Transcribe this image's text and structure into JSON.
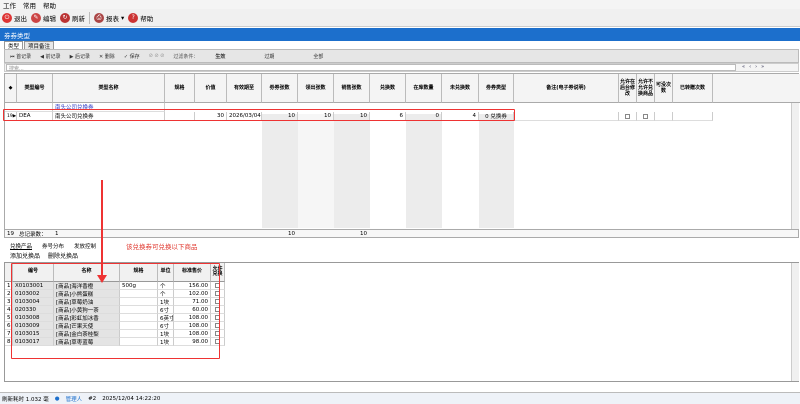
{
  "menu": {
    "items": [
      "工作",
      "常用",
      "帮助"
    ]
  },
  "toolbar": {
    "exit": "退出",
    "edit": "编辑",
    "refresh": "刷新",
    "report": "报表",
    "help": "帮助"
  },
  "window_title": "劵券类型",
  "tabs": [
    "类型",
    "项目备注"
  ],
  "nav": {
    "first": "首记录",
    "prev": "前记录",
    "next": "后记录",
    "del": "删除",
    "save": "保存",
    "filter_label": "过滤条件：",
    "status": "生效",
    "expired": "过期",
    "all": "全部"
  },
  "search_placeholder": "搜索...",
  "grid": {
    "headers": [
      "类型编号",
      "类型名称",
      "规格",
      "价值",
      "有效期至",
      "劵券张数",
      "领出张数",
      "销售张数",
      "兑换数",
      "在库数量",
      "未兑换数",
      "劵券类型",
      "备注(电子券说明)",
      "允许在后台修改",
      "允许不允许兑换商品",
      "可没次数",
      "已转赠次数"
    ],
    "filter_row_name": "南头公司兑换券",
    "row": {
      "num": "19",
      "code": "DEA",
      "name": "南头公司兑换券",
      "value": "30",
      "expiry": "2026/03/04",
      "issued": "10",
      "taken": "10",
      "sold": "10",
      "redeemed": "6",
      "stock": "0",
      "unredeemed": "4",
      "coupon_type": "0 兑换券"
    },
    "summary": {
      "count": "19",
      "label": "总记录数：",
      "rows": "1",
      "issued": "10",
      "sold": "10"
    }
  },
  "bottom_tabs": [
    "兑换产品",
    "券号分布",
    "发放控制"
  ],
  "annotation": "该兑换券可兑换以下商品",
  "actions": {
    "add": "添加兑换品",
    "remove": "删除兑换品"
  },
  "subgrid": {
    "headers": [
      "编号",
      "名称",
      "规格",
      "单位",
      "标准售价",
      "允许兑换"
    ],
    "rows": [
      {
        "num": "1",
        "code": "X0103001",
        "name": "[商品]海洋香橙",
        "spec": "500g",
        "unit": "个",
        "price": "156.00"
      },
      {
        "num": "2",
        "code": "0103002",
        "name": "[商品]小熊蛋糕",
        "spec": "",
        "unit": "个",
        "price": "102.00"
      },
      {
        "num": "3",
        "code": "0103004",
        "name": "[商品]草莓奶油",
        "spec": "",
        "unit": "1块",
        "price": "71.00"
      },
      {
        "num": "4",
        "code": "020330",
        "name": "[商品]小黄狗一茶",
        "spec": "",
        "unit": "6寸",
        "price": "60.00"
      },
      {
        "num": "5",
        "code": "0103008",
        "name": "[商品]彩虹加冰香",
        "spec": "",
        "unit": "6英寸",
        "price": "108.00"
      },
      {
        "num": "6",
        "code": "0103009",
        "name": "[商品]芒果天使",
        "spec": "",
        "unit": "6寸",
        "price": "108.00"
      },
      {
        "num": "7",
        "code": "0103015",
        "name": "[商品]金白茶桂梨",
        "spec": "",
        "unit": "1块",
        "price": "108.00"
      },
      {
        "num": "8",
        "code": "0103017",
        "name": "[商品]草枣蓝莓",
        "spec": "",
        "unit": "1块",
        "price": "98.00"
      }
    ]
  },
  "status": {
    "time": "刷新耗时 1.032 毫",
    "user": "管理人",
    "id": "#2",
    "date": "2025/12/04 14:22:20"
  },
  "colors": {
    "accent": "#1c6fcc",
    "highlight": "#e33"
  }
}
